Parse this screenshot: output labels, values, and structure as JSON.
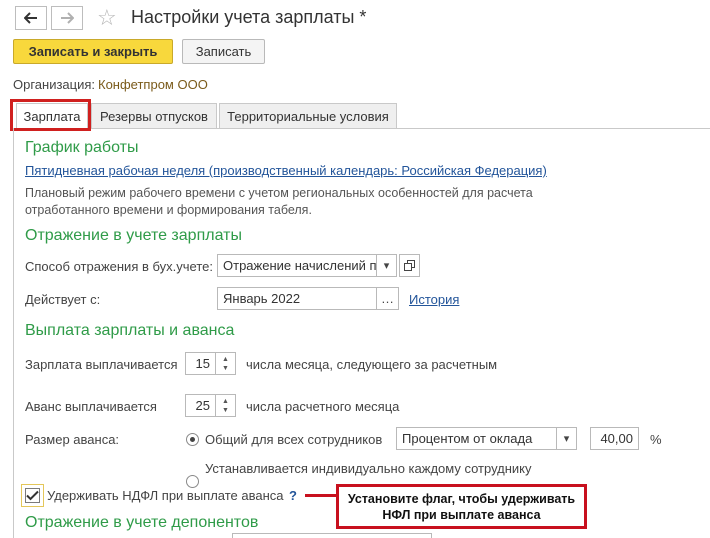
{
  "header": {
    "title": "Настройки учета зарплаты *",
    "back_icon": "arrow-left-icon",
    "forward_icon": "arrow-right-icon",
    "favorite_icon": "star-icon"
  },
  "toolbar": {
    "save_close_label": "Записать и закрыть",
    "save_label": "Записать"
  },
  "organization": {
    "label": "Организация:",
    "value": "Конфетпром ООО"
  },
  "tabs": [
    {
      "label": "Зарплата",
      "active": true
    },
    {
      "label": "Резервы отпусков",
      "active": false
    },
    {
      "label": "Территориальные условия",
      "active": false
    }
  ],
  "schedule": {
    "heading": "График работы",
    "link": "Пятидневная рабочая неделя (производственный календарь: Российская Федерация)",
    "description_line1": "Плановый режим рабочего времени с учетом региональных особенностей для расчета",
    "description_line2": "отработанного времени и формирования табеля."
  },
  "accounting": {
    "heading": "Отражение в учете зарплаты",
    "method_label": "Способ отражения в бух.учете:",
    "method_value": "Отражение начислений по",
    "effective_label": "Действует с:",
    "effective_value": "Январь 2022",
    "history_link": "История"
  },
  "payment": {
    "heading": "Выплата зарплаты и аванса",
    "salary_label": "Зарплата выплачивается",
    "salary_day": "15",
    "salary_suffix": "числа месяца, следующего за расчетным",
    "advance_label": "Аванс выплачивается",
    "advance_day": "25",
    "advance_suffix": "числа расчетного месяца",
    "advance_size_label": "Размер аванса:",
    "option_common": "Общий для всех сотрудников",
    "option_common_selected": true,
    "method_select": "Процентом от оклада",
    "percent_value": "40,00",
    "percent_unit": "%",
    "option_individual": "Устанавливается индивидуально каждому сотруднику"
  },
  "ndfl": {
    "checkbox_label": "Удерживать НДФЛ при выплате аванса",
    "checked": true,
    "help": "?"
  },
  "callout": {
    "line1": "Установите флаг, чтобы удерживать",
    "line2": "НФЛ при выплате аванса"
  },
  "deponents": {
    "heading": "Отражение в учете депонентов"
  },
  "colors": {
    "section_green": "#2f9b48",
    "link_blue": "#23559a",
    "primary_yellow": "#f8d83c",
    "highlight_red": "#d0201f"
  }
}
